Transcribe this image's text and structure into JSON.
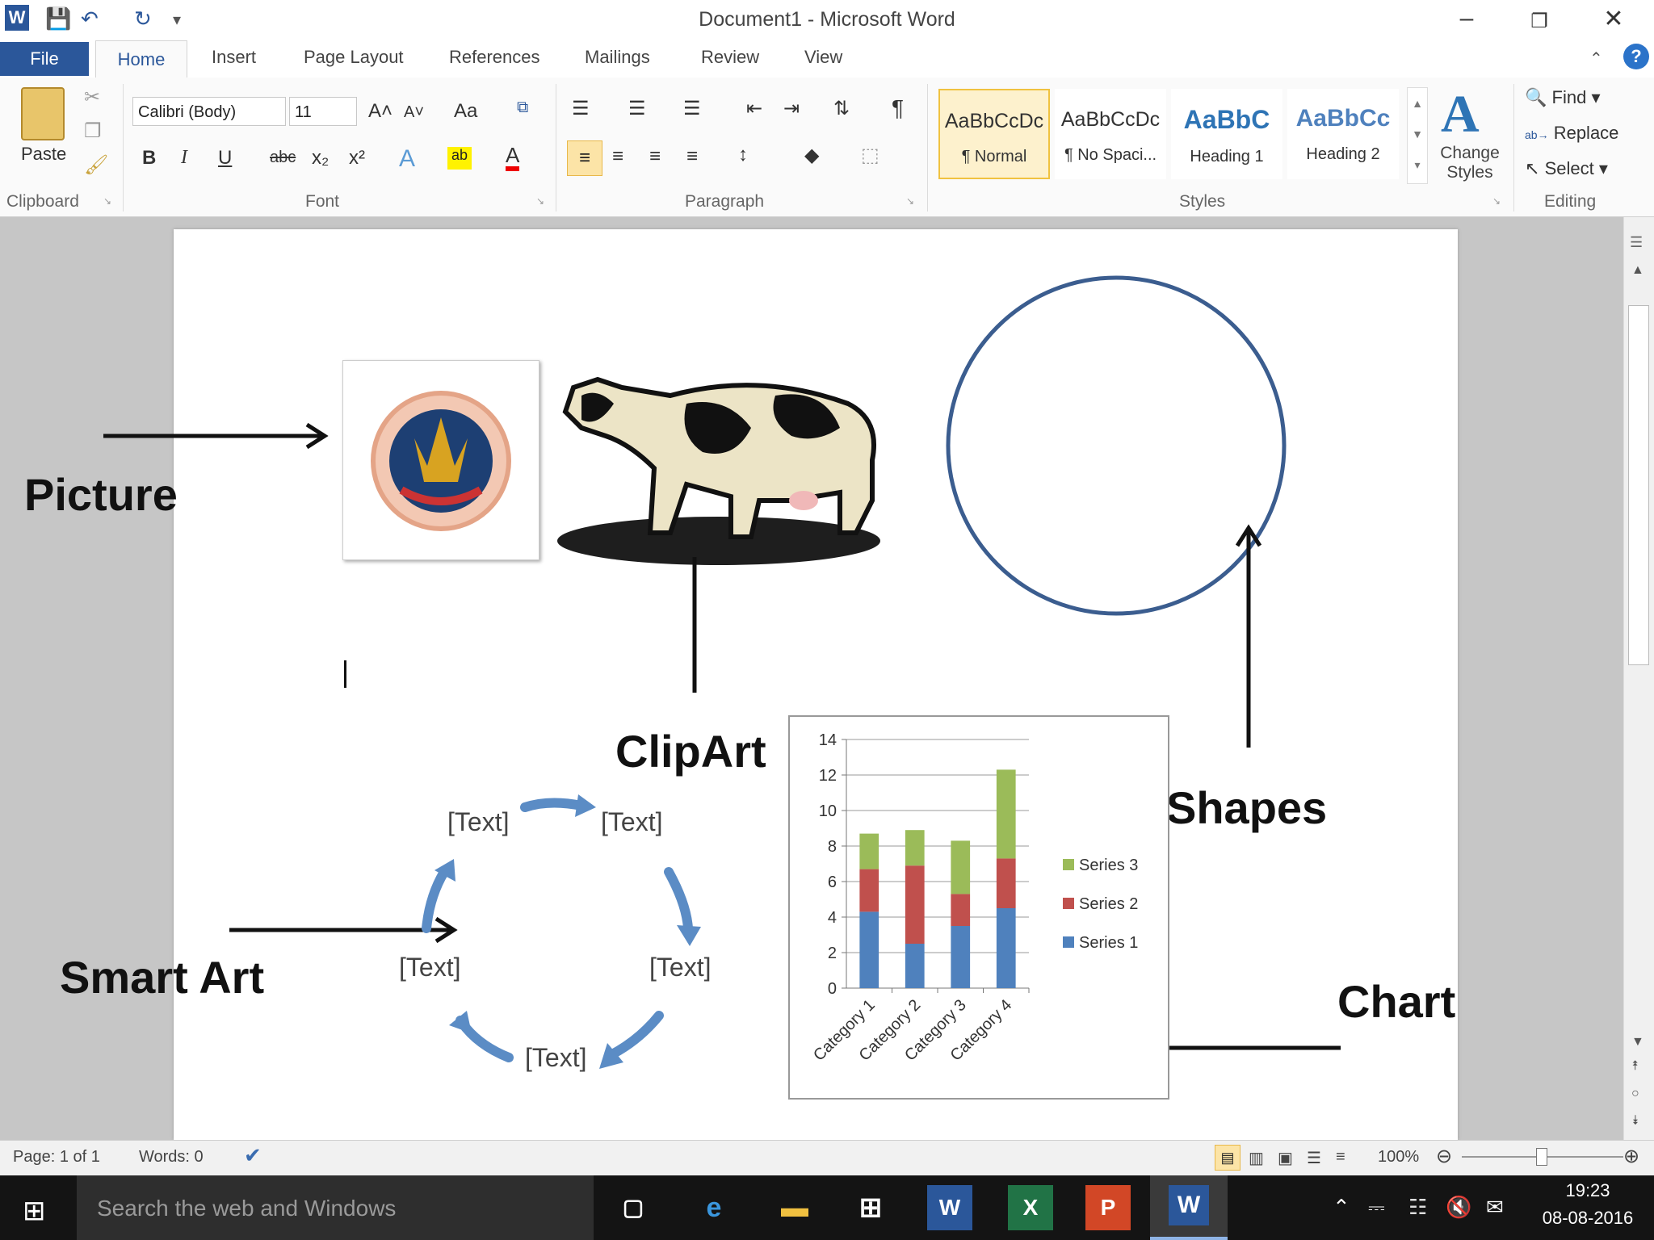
{
  "window": {
    "title": "Document1 - Microsoft Word"
  },
  "tabs": {
    "file": "File",
    "home": "Home",
    "items": [
      "Insert",
      "Page Layout",
      "References",
      "Mailings",
      "Review",
      "View"
    ]
  },
  "ribbon": {
    "clipboard": {
      "paste": "Paste",
      "label": "Clipboard"
    },
    "font": {
      "name": "Calibri (Body)",
      "size": "11",
      "label": "Font"
    },
    "paragraph": {
      "label": "Paragraph"
    },
    "styles": {
      "label": "Styles",
      "tiles": [
        {
          "preview": "AaBbCcDc",
          "name": "¶ Normal"
        },
        {
          "preview": "AaBbCcDc",
          "name": "¶ No Spaci..."
        },
        {
          "preview": "AaBbC",
          "name": "Heading 1"
        },
        {
          "preview": "AaBbCc",
          "name": "Heading 2"
        }
      ],
      "change_styles": "Change Styles"
    },
    "editing": {
      "label": "Editing",
      "find": "Find",
      "replace": "Replace",
      "select": "Select"
    }
  },
  "document": {
    "callouts": {
      "picture": "Picture",
      "clipart": "ClipArt",
      "shapes": "Shapes",
      "smartart": "Smart Art",
      "chart": "Chart"
    },
    "smartart": [
      "[Text]",
      "[Text]",
      "[Text]",
      "[Text]",
      "[Text]"
    ]
  },
  "chart_data": {
    "type": "bar",
    "stacked": true,
    "categories": [
      "Category 1",
      "Category 2",
      "Category 3",
      "Category 4"
    ],
    "series": [
      {
        "name": "Series 1",
        "values": [
          4.3,
          2.5,
          3.5,
          4.5
        ],
        "color": "#4f81bd"
      },
      {
        "name": "Series 2",
        "values": [
          2.4,
          4.4,
          1.8,
          2.8
        ],
        "color": "#c0504d"
      },
      {
        "name": "Series 3",
        "values": [
          2.0,
          2.0,
          3.0,
          5.0
        ],
        "color": "#9bbb59"
      }
    ],
    "ylim": [
      0,
      14
    ],
    "yticks": [
      "0",
      "2",
      "4",
      "6",
      "8",
      "10",
      "12",
      "14"
    ],
    "legend": "right",
    "grid": true
  },
  "statusbar": {
    "page": "Page: 1 of 1",
    "words": "Words: 0",
    "zoom": "100%"
  },
  "taskbar": {
    "search": "Search the web and Windows",
    "time": "19:23",
    "date": "08-08-2016"
  }
}
